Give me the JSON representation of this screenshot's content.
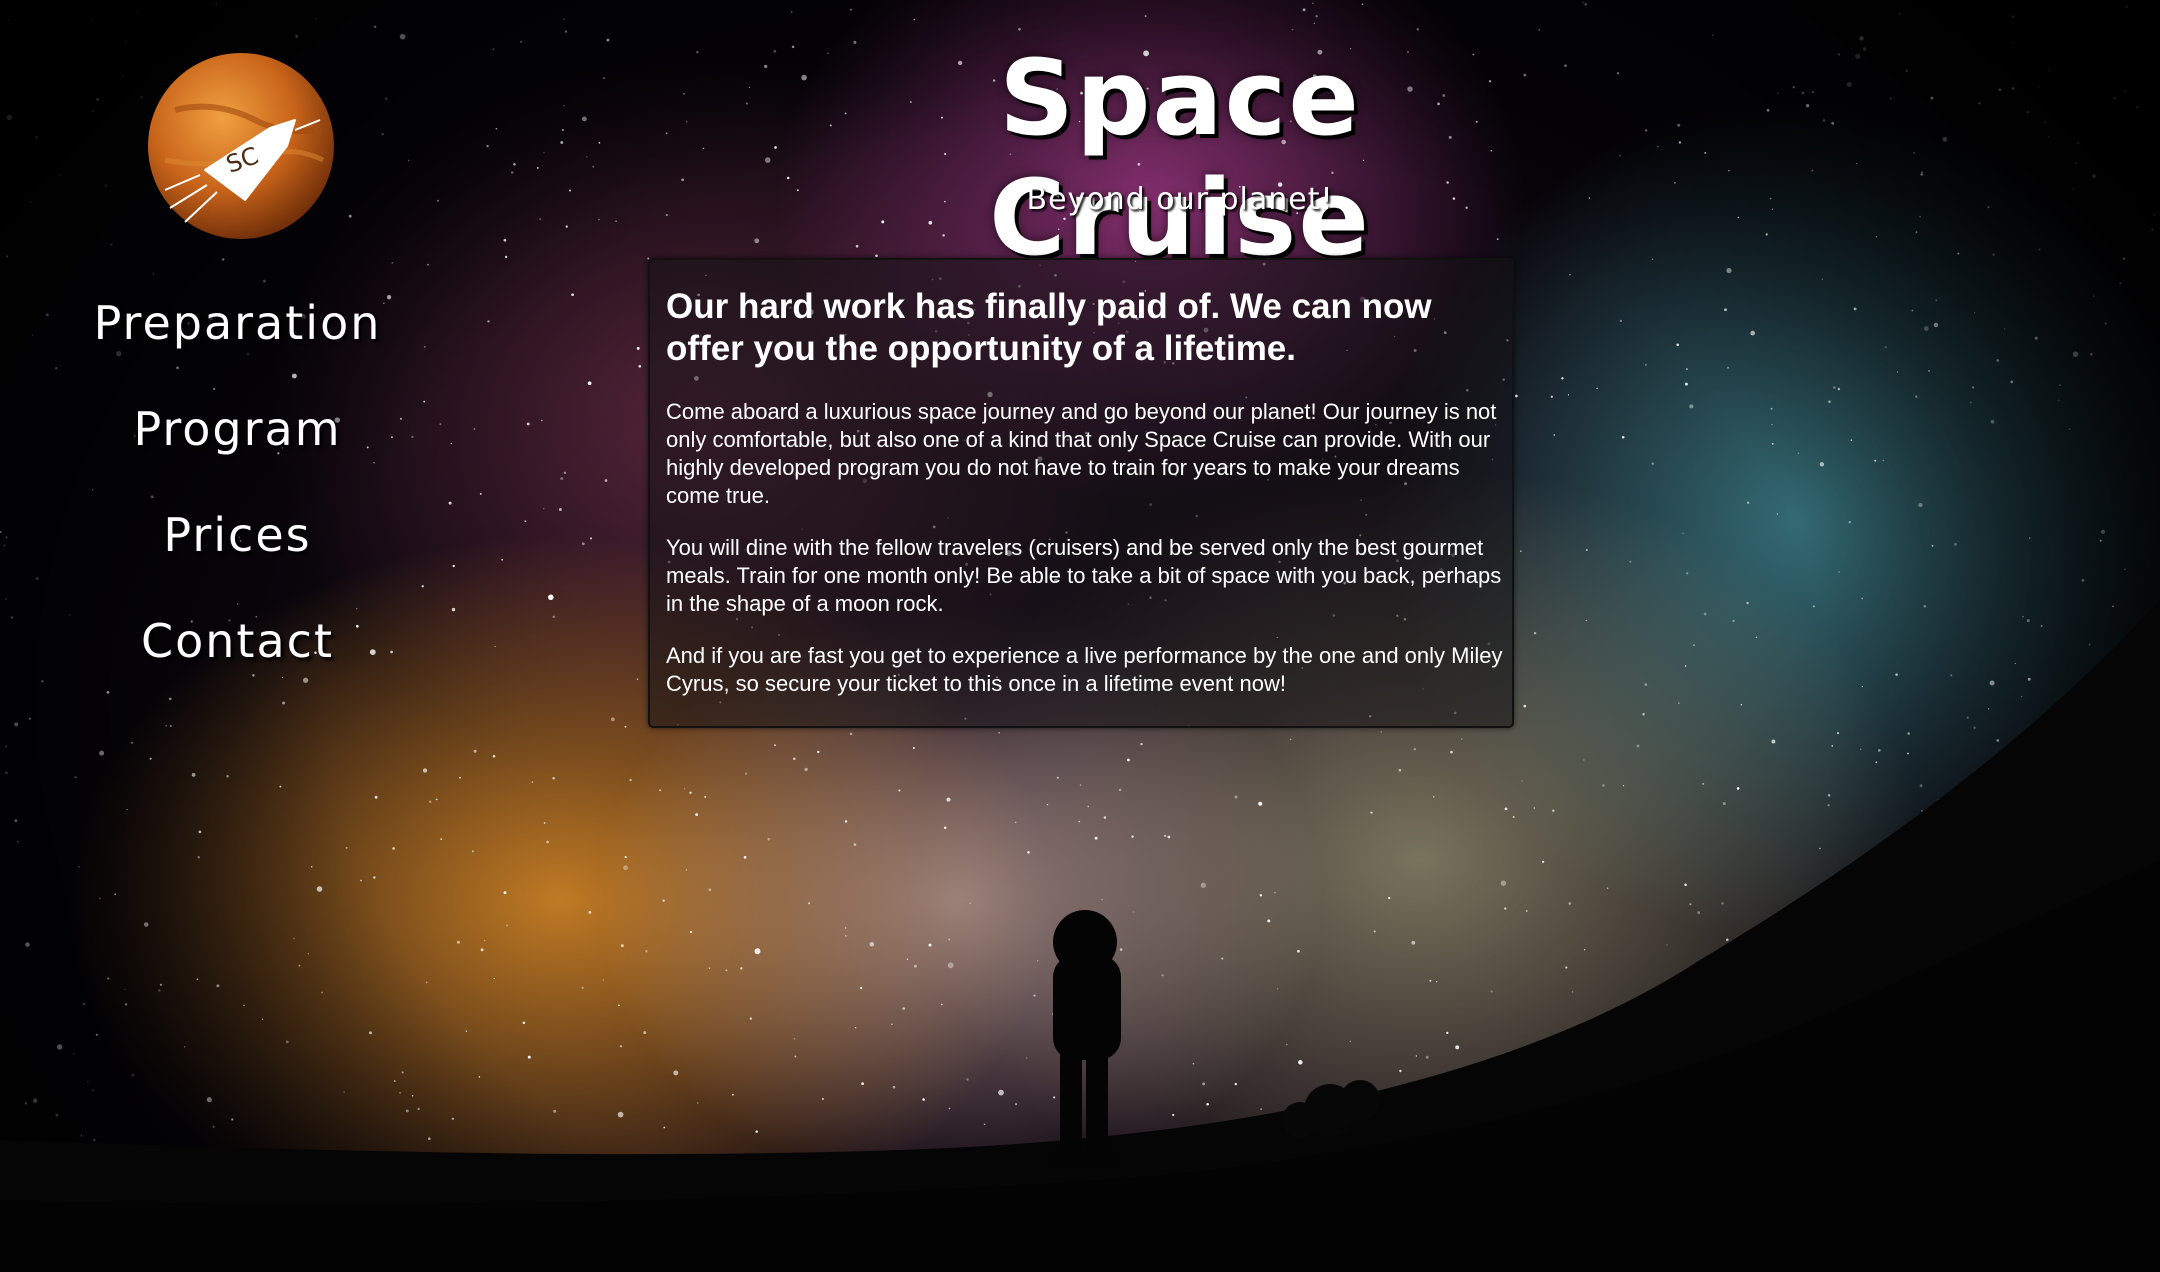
{
  "site": {
    "title": "Space Cruise",
    "tagline": "Beyond our planet!",
    "logo_text": "SC"
  },
  "nav": {
    "items": [
      {
        "label": "Preparation"
      },
      {
        "label": "Program"
      },
      {
        "label": "Prices"
      },
      {
        "label": "Contact"
      }
    ]
  },
  "content": {
    "heading": "Our hard work has finally paid of. We can now offer you the opportunity of a lifetime.",
    "paragraphs": [
      "Come aboard a luxurious space journey and go beyond our planet! Our journey is not only comfortable, but also one of a kind that only Space Cruise can provide. With our highly developed program you do not have to train for years to make your dreams come true.",
      "You will dine with the fellow travelers (cruisers) and be served only the best gourmet meals. Train for one month only! Be able to take a bit of space with you back, perhaps in the shape of a moon rock.",
      "And if you are fast you get to experience a live performance by the one and only Miley Cyrus, so secure your ticket to this once in a lifetime event now!"
    ]
  },
  "colors": {
    "text": "#ffffff",
    "panel_bg": "rgba(20,18,22,0.55)",
    "planet": "#c8641a"
  },
  "icons": {
    "logo": "planet-rocket-logo"
  }
}
